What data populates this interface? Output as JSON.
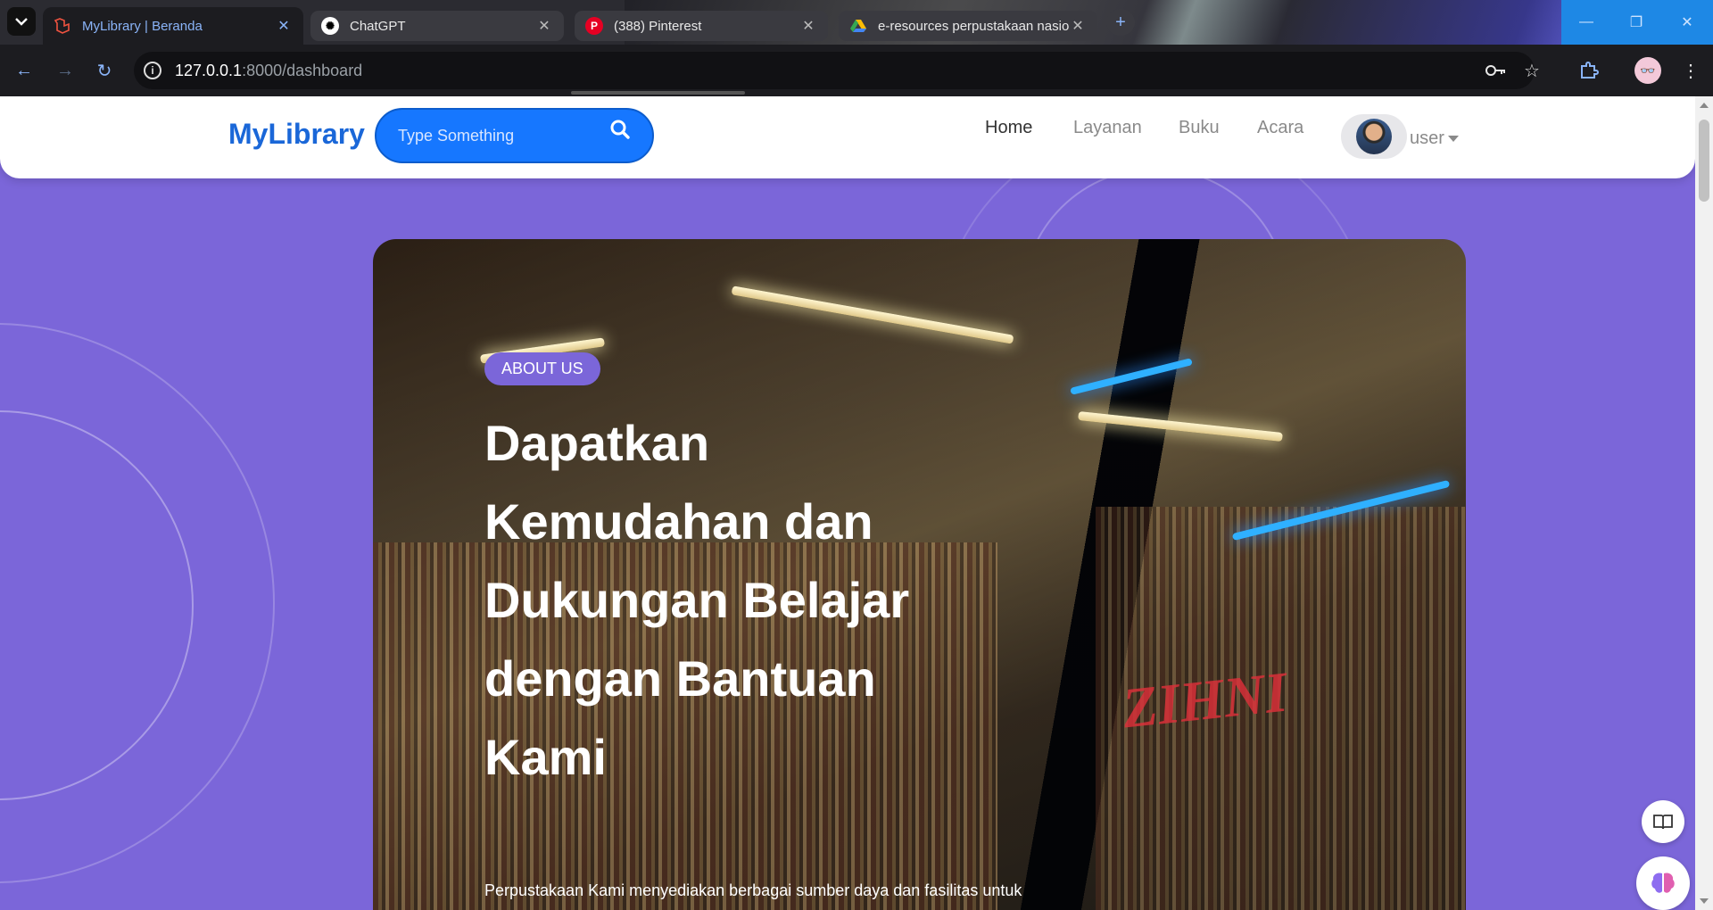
{
  "browser": {
    "tabs": [
      {
        "title": "MyLibrary | Beranda",
        "favicon": "laravel-icon",
        "active": true
      },
      {
        "title": "ChatGPT",
        "favicon": "chatgpt-icon",
        "active": false
      },
      {
        "title": "(388) Pinterest",
        "favicon": "pinterest-icon",
        "active": false
      },
      {
        "title": "e-resources perpustakaan nasio",
        "favicon": "drive-icon",
        "active": false
      }
    ],
    "url_host": "127.0.0.1",
    "url_rest": ":8000/dashboard",
    "accent": "#8ab4f8"
  },
  "site": {
    "brand": "MyLibrary",
    "search_placeholder": "Type Something",
    "nav": [
      {
        "label": "Home",
        "active": true
      },
      {
        "label": "Layanan",
        "active": false
      },
      {
        "label": "Buku",
        "active": false
      },
      {
        "label": "Acara",
        "active": false
      }
    ],
    "user_label": "user",
    "brand_color": "#1a67d8",
    "page_bg": "#7b66d9"
  },
  "hero": {
    "badge": "ABOUT US",
    "headline": "Dapatkan Kemudahan dan Dukungan Belajar dengan Bantuan Kami",
    "subtext": "Perpustakaan Kami menyediakan berbagai sumber daya dan fasilitas untuk"
  }
}
